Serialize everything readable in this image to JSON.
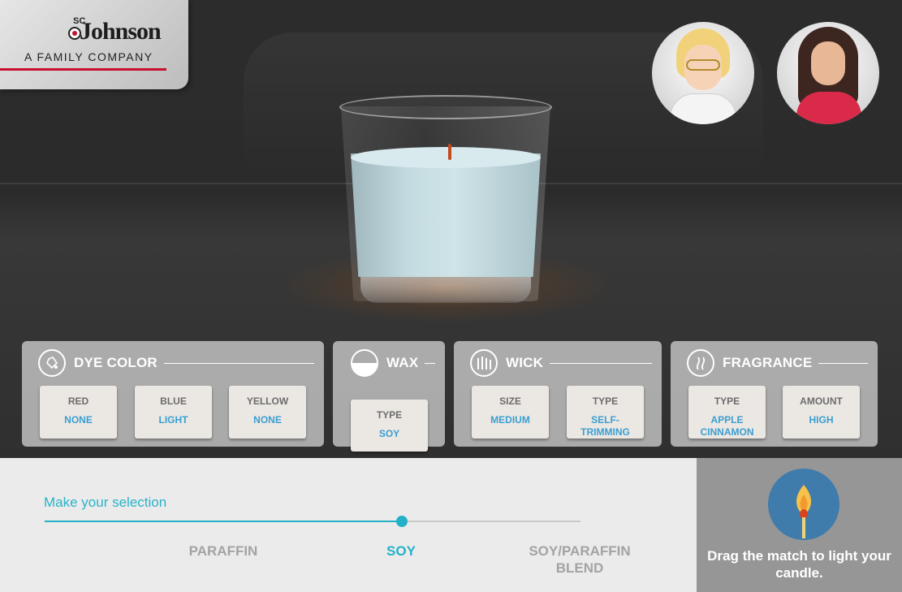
{
  "brand": {
    "logo_top": "SC",
    "logo_name": "Johnson",
    "tagline": "A FAMILY COMPANY"
  },
  "characters": [
    {
      "icon": "scientist-avatar-icon"
    },
    {
      "icon": "host-avatar-icon"
    }
  ],
  "candle": {
    "wax_color": "#c6dde2",
    "icon": "candle-jar-icon"
  },
  "panels": {
    "dye": {
      "title": "DYE COLOR",
      "icon": "dye-bottle-icon",
      "options": [
        {
          "label": "RED",
          "value": "NONE"
        },
        {
          "label": "BLUE",
          "value": "LIGHT"
        },
        {
          "label": "YELLOW",
          "value": "NONE"
        }
      ]
    },
    "wax": {
      "title": "WAX",
      "icon": "wax-icon",
      "options": [
        {
          "label": "TYPE",
          "value": "SOY"
        }
      ]
    },
    "wick": {
      "title": "WICK",
      "icon": "wick-icon",
      "options": [
        {
          "label": "SIZE",
          "value": "MEDIUM"
        },
        {
          "label": "TYPE",
          "value": "SELF-TRIMMING"
        }
      ]
    },
    "fragrance": {
      "title": "FRAGRANCE",
      "icon": "fragrance-icon",
      "options": [
        {
          "label": "TYPE",
          "value": "APPLE CINNAMON"
        },
        {
          "label": "AMOUNT",
          "value": "HIGH"
        }
      ]
    }
  },
  "selection": {
    "prompt": "Make your selection",
    "options": [
      "PARAFFIN",
      "SOY",
      "SOY/PARAFFIN BLEND"
    ],
    "selected_index": 1,
    "slider_position": 0.667
  },
  "match": {
    "icon": "match-flame-icon",
    "instruction": "Drag the match to light your candle."
  },
  "colors": {
    "accent": "#22b1c7",
    "value_blue": "#3a9fd1",
    "brand_red": "#c8102e"
  }
}
